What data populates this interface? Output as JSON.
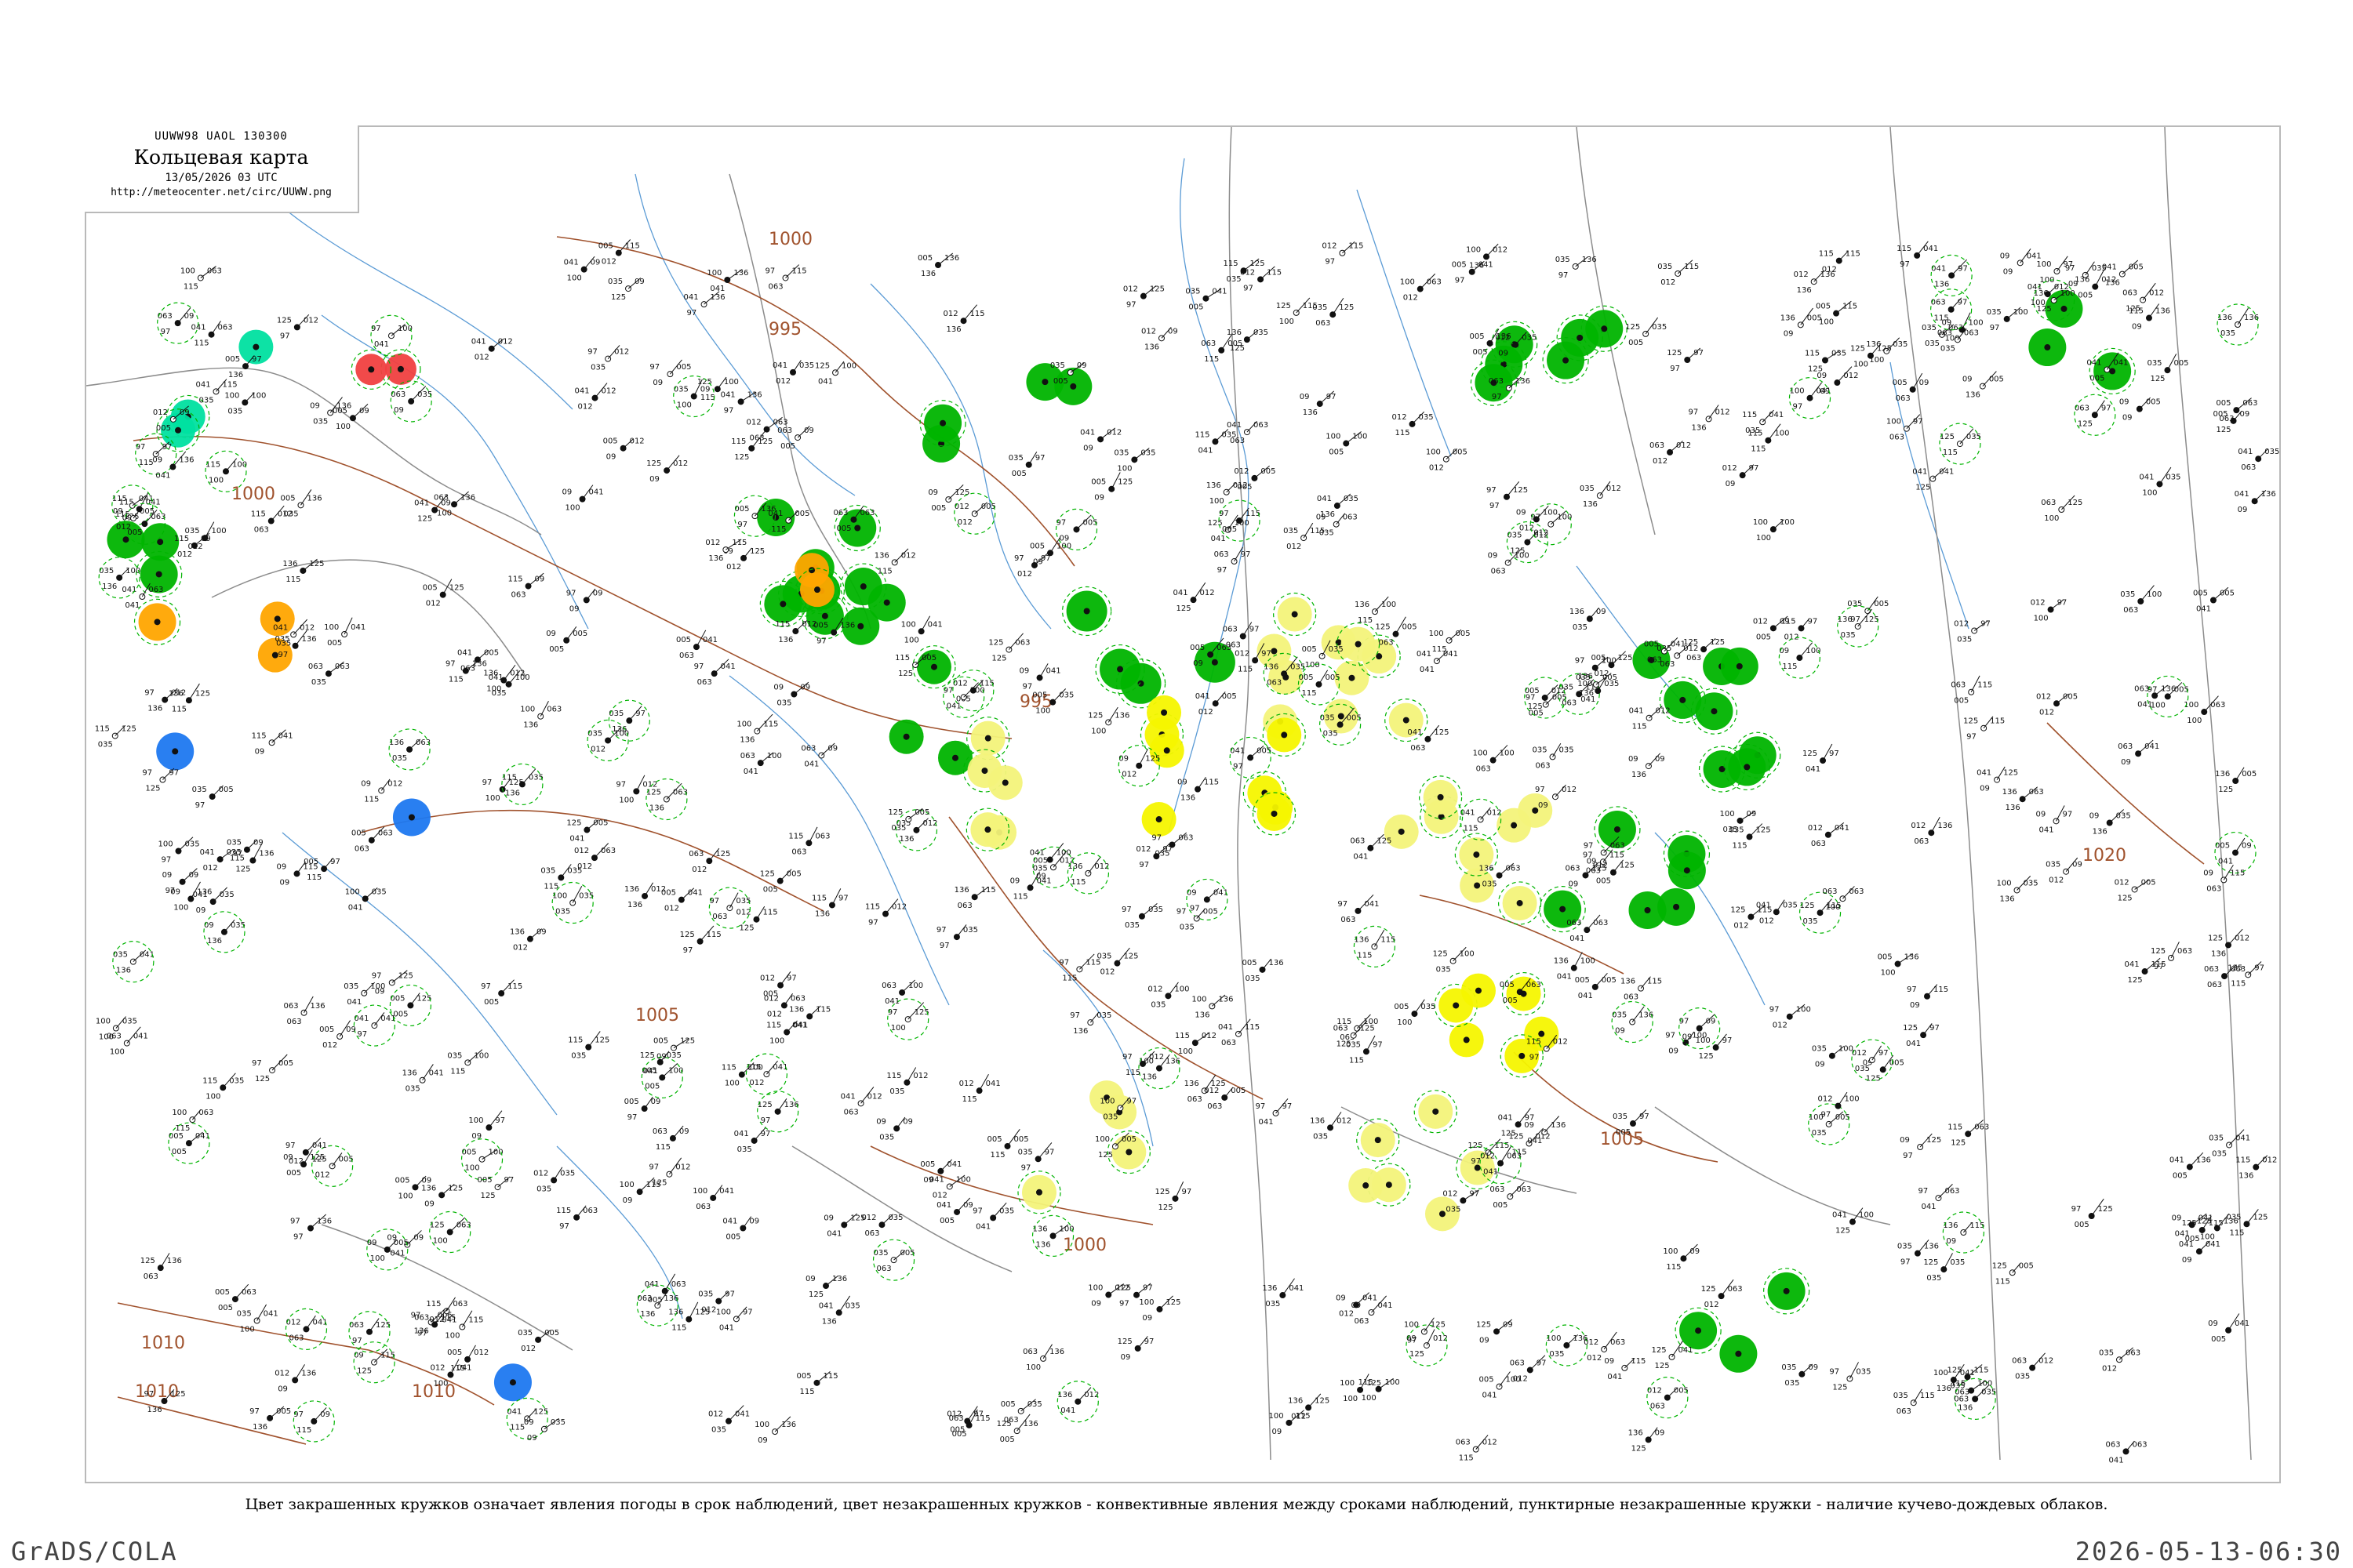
{
  "header": {
    "code": "UUWW98  UAOL  130300",
    "title": "Кольцевая карта",
    "time": "13/05/2026 03 UTC",
    "url": "http://meteocenter.net/circ/UUWW.png"
  },
  "map": {
    "isobars": [
      "1000",
      "995",
      "1000",
      "995",
      "1005",
      "1005",
      "1000",
      "1010",
      "1010",
      "1010",
      "1020"
    ],
    "colors": {
      "isobar": "#a0522d",
      "river": "#5b9bd5",
      "border": "#8c8c8c",
      "rain": "#00b400",
      "drizzle_light": "#f3f37a",
      "haze": "#f5f500",
      "fog": "#ffa500",
      "snow": "#00e0a0",
      "thunder": "#f04040",
      "shower": "#1e78f0",
      "convective_ring": "#00b400"
    },
    "station_samples": [
      "97",
      "09",
      "005",
      "035",
      "115",
      "136",
      "125",
      "100",
      "063",
      "041",
      "012"
    ]
  },
  "caption": "Цвет закрашенных кружков означает явления погоды в срок наблюдений, цвет незакрашенных кружков - конвективные явления между сроками наблюдений, пунктирные незакрашенные кружки - наличие кучево-дождевых облаков.",
  "footer": {
    "left": "GrADS/COLA",
    "right": "2026-05-13-06:30"
  }
}
